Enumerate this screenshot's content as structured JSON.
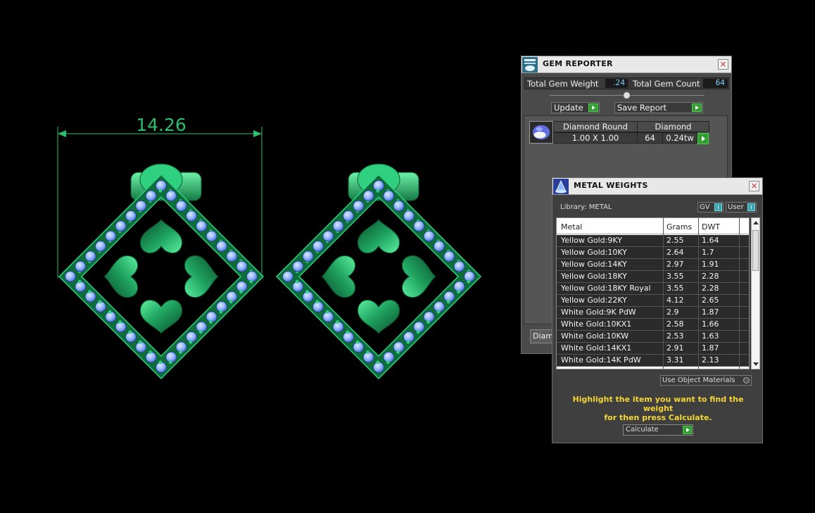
{
  "viewport": {
    "dimension_label": "14.26"
  },
  "gem_reporter": {
    "title": "GEM REPORTER",
    "close_label": "×",
    "total_weight_label": "Total Gem Weight",
    "total_weight_value": ".24",
    "total_count_label": "Total Gem Count",
    "total_count_value": "64",
    "update_label": "Update",
    "save_report_label": "Save Report",
    "gem": {
      "shape": "Diamond Round",
      "size": "1.00 X 1.00",
      "type": "Diamond",
      "count": "64",
      "weight": "0.24tw"
    },
    "bottom_tab": "Diamond"
  },
  "metal_weights": {
    "title": "METAL WEIGHTS",
    "close_label": "×",
    "library_label": "Library: METAL",
    "gv_label": "GV",
    "user_label": "User",
    "columns": [
      "Metal",
      "Grams",
      "DWT"
    ],
    "rows": [
      {
        "metal": "Yellow Gold:9KY",
        "grams": "2.55",
        "dwt": "1.64"
      },
      {
        "metal": "Yellow Gold:10KY",
        "grams": "2.64",
        "dwt": "1.7"
      },
      {
        "metal": "Yellow Gold:14KY",
        "grams": "2.97",
        "dwt": "1.91"
      },
      {
        "metal": "Yellow Gold:18KY",
        "grams": "3.55",
        "dwt": "2.28"
      },
      {
        "metal": "Yellow Gold:18KY Royal",
        "grams": "3.55",
        "dwt": "2.28"
      },
      {
        "metal": "Yellow Gold:22KY",
        "grams": "4.12",
        "dwt": "2.65"
      },
      {
        "metal": "White Gold:9K PdW",
        "grams": "2.9",
        "dwt": "1.87"
      },
      {
        "metal": "White Gold:10KX1",
        "grams": "2.58",
        "dwt": "1.66"
      },
      {
        "metal": "White Gold:10KW",
        "grams": "2.53",
        "dwt": "1.63"
      },
      {
        "metal": "White Gold:14KX1",
        "grams": "2.91",
        "dwt": "1.87"
      },
      {
        "metal": "White Gold:14K PdW",
        "grams": "3.31",
        "dwt": "2.13"
      }
    ],
    "use_object_materials_label": "Use Object Materials",
    "hint_line1": "Highlight the item you want to find the weight",
    "hint_line2": "for then press Calculate.",
    "calculate_label": "Calculate"
  },
  "colors": {
    "metal_green": "#1fa35f",
    "gem_blue": "#8fb3ff",
    "dimension_green": "#2bbf6a",
    "hint_yellow": "#f5d632"
  }
}
